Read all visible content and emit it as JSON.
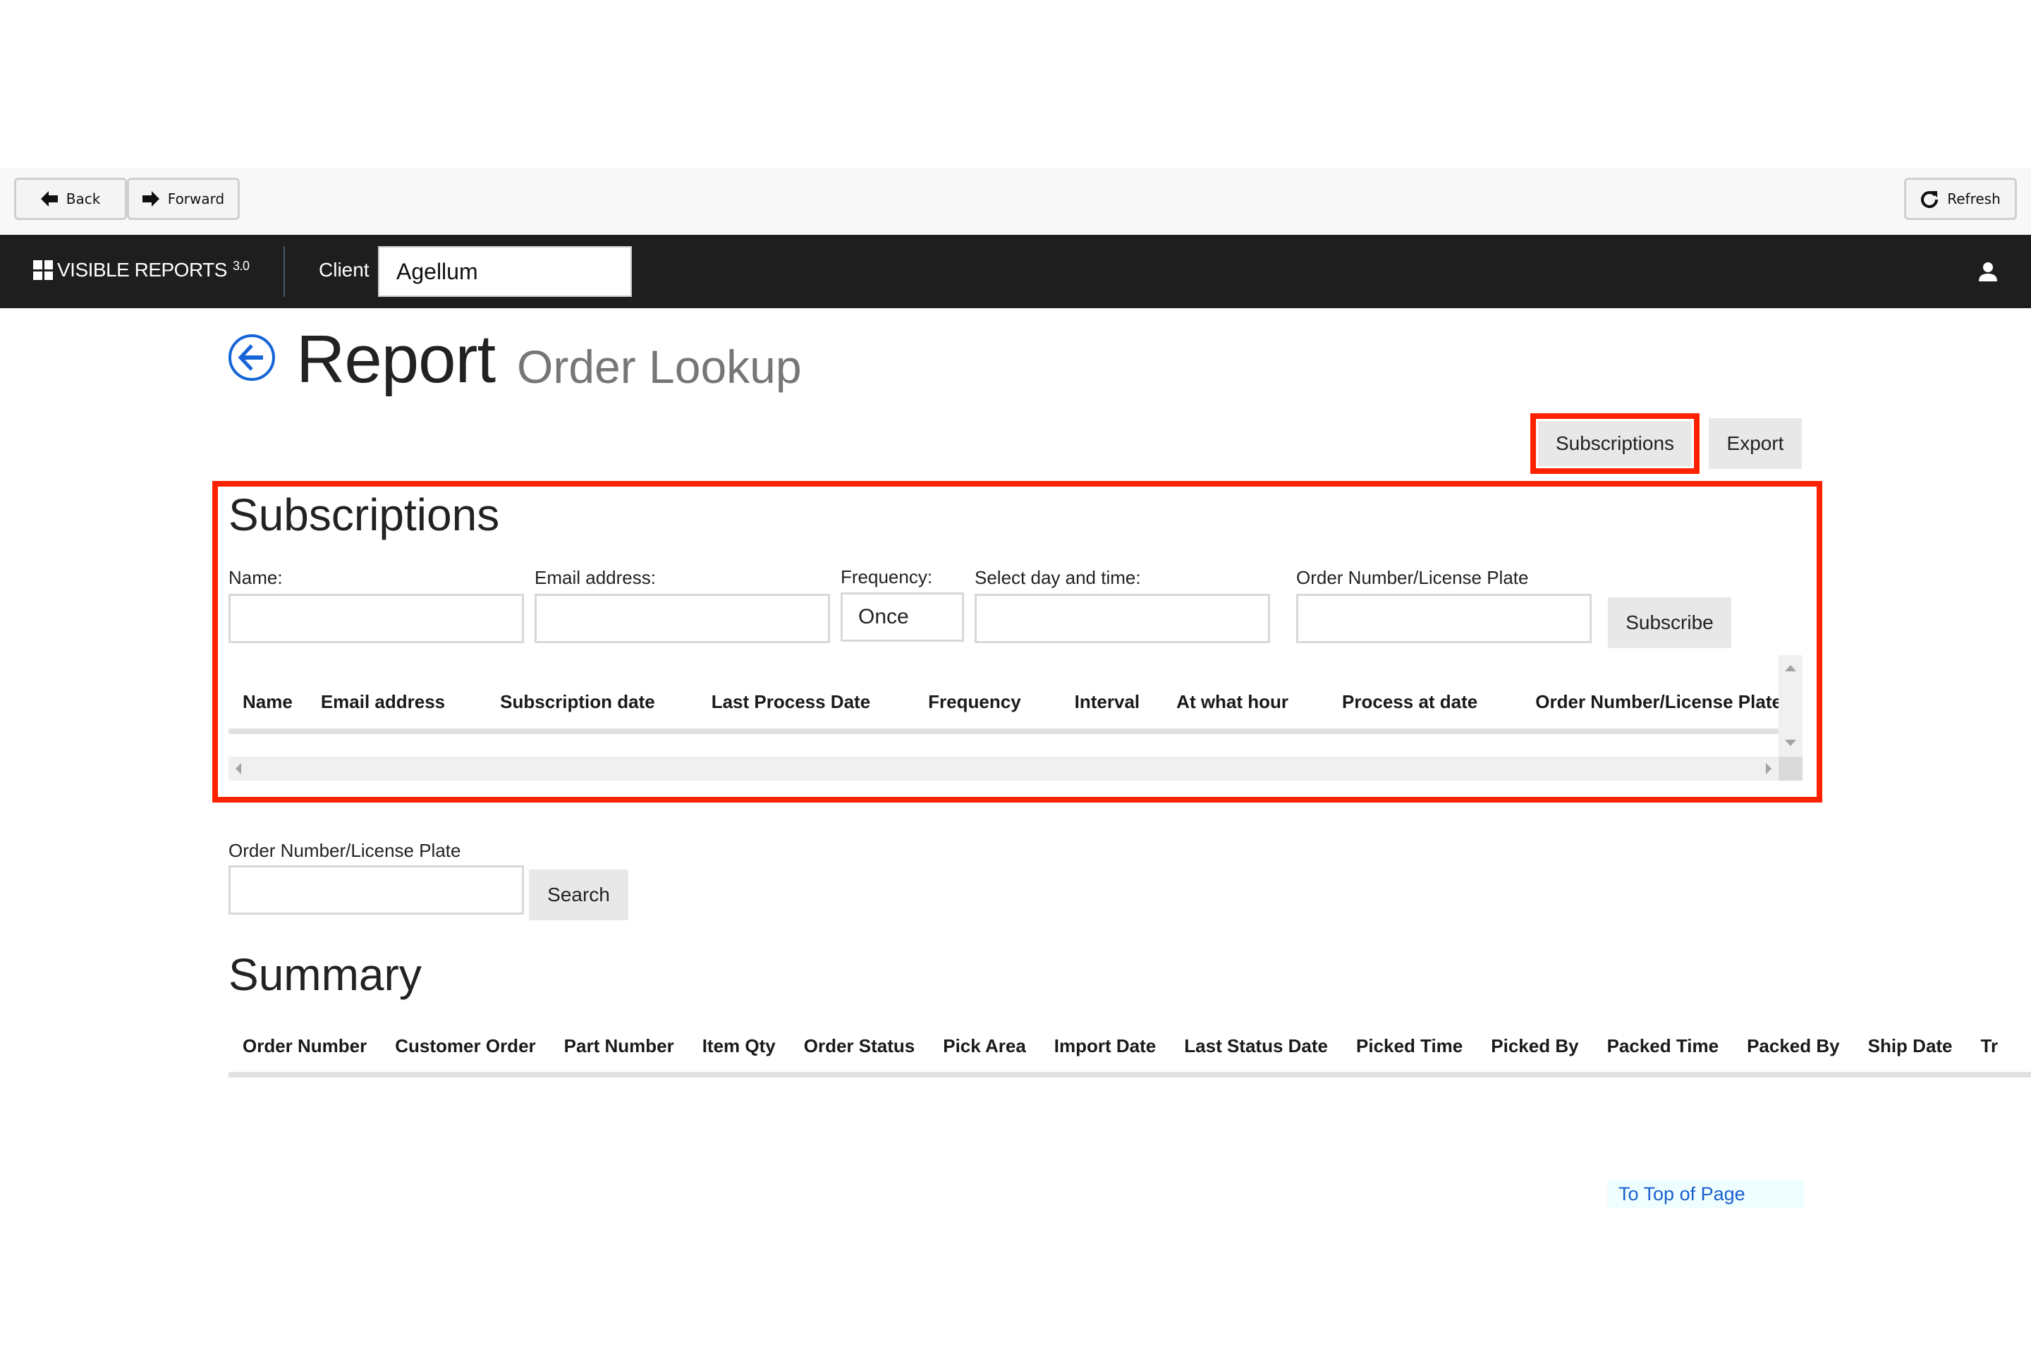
{
  "toolbar": {
    "back_label": "Back",
    "forward_label": "Forward",
    "refresh_label": "Refresh"
  },
  "navbar": {
    "app_name": "VISIBLE REPORTS",
    "app_version": "3.0",
    "client_label": "Client",
    "client_value": "Agellum"
  },
  "header": {
    "title": "Report",
    "subtitle": "Order Lookup"
  },
  "actions": {
    "subscriptions_label": "Subscriptions",
    "export_label": "Export"
  },
  "subscriptions": {
    "title": "Subscriptions",
    "fields": {
      "name_label": "Name:",
      "name_value": "",
      "email_label": "Email address:",
      "email_value": "",
      "frequency_label": "Frequency:",
      "frequency_value": "Once",
      "schedule_label": "Select day and time:",
      "schedule_value": "",
      "order_label": "Order Number/License Plate",
      "order_value": ""
    },
    "subscribe_label": "Subscribe",
    "columns": [
      "Name",
      "Email address",
      "Subscription date",
      "Last Process Date",
      "Frequency",
      "Interval",
      "At what hour",
      "Process at date",
      "Order Number/License Plates"
    ],
    "rows": []
  },
  "search": {
    "label": "Order Number/License Plate",
    "value": "",
    "button_label": "Search"
  },
  "summary": {
    "title": "Summary",
    "columns": [
      "Order Number",
      "Customer Order",
      "Part Number",
      "Item Qty",
      "Order Status",
      "Pick Area",
      "Import Date",
      "Last Status Date",
      "Picked Time",
      "Picked By",
      "Packed Time",
      "Packed By",
      "Ship Date",
      "Tr"
    ],
    "rows": []
  },
  "footer": {
    "to_top_label": "To Top of Page"
  },
  "colors": {
    "highlight": "#ff2200",
    "navbar_bg": "#1e1e1e",
    "link": "#1a5fd0",
    "back_icon": "#1565d8"
  }
}
